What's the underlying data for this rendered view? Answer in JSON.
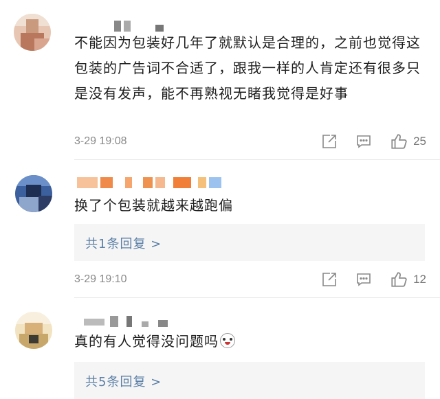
{
  "comments": [
    {
      "text": "不能因为包装好几年了就默认是合理的，之前也觉得这包装的广告词不合适了，跟我一样的人肯定还有很多只是没有发声，能不再熟视无睹我觉得是好事",
      "time": "3-29 19:08",
      "like_count": "25"
    },
    {
      "text": "换了个包装就越来越跑偏",
      "replies_label": "共1条回复 >",
      "time": "3-29 19:10",
      "like_count": "12"
    },
    {
      "text": "真的有人觉得没问题吗",
      "replies_label": "共5条回复 >"
    }
  ],
  "icons": {
    "share": "share-icon",
    "comment": "comment-icon",
    "like": "thumbs-up-icon",
    "emoji": "husky-emoji-icon"
  },
  "colors": {
    "link": "#5b7fa6",
    "meta": "#8a8a8a",
    "reply_bg": "#f5f5f5"
  }
}
